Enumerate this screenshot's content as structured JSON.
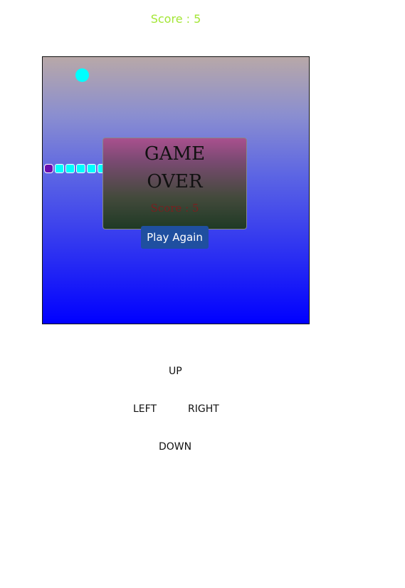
{
  "score_display": "Score : 5",
  "game_over": {
    "title": "GAME OVER",
    "score": "Score : 5",
    "play_again_label": "Play Again"
  },
  "snake": {
    "segment_count": 7,
    "head_color": "#6a0dad",
    "body_color": "#00ffff"
  },
  "food": {
    "color": "#00ffff"
  },
  "controls": {
    "up": "UP",
    "left": "LEFT",
    "right": "RIGHT",
    "down": "DOWN"
  },
  "colors": {
    "score_text": "#a3e635",
    "board_gradient_top": "#b8a8a8",
    "board_gradient_bottom": "#0000ff",
    "button_bg": "#1f4fa0"
  }
}
